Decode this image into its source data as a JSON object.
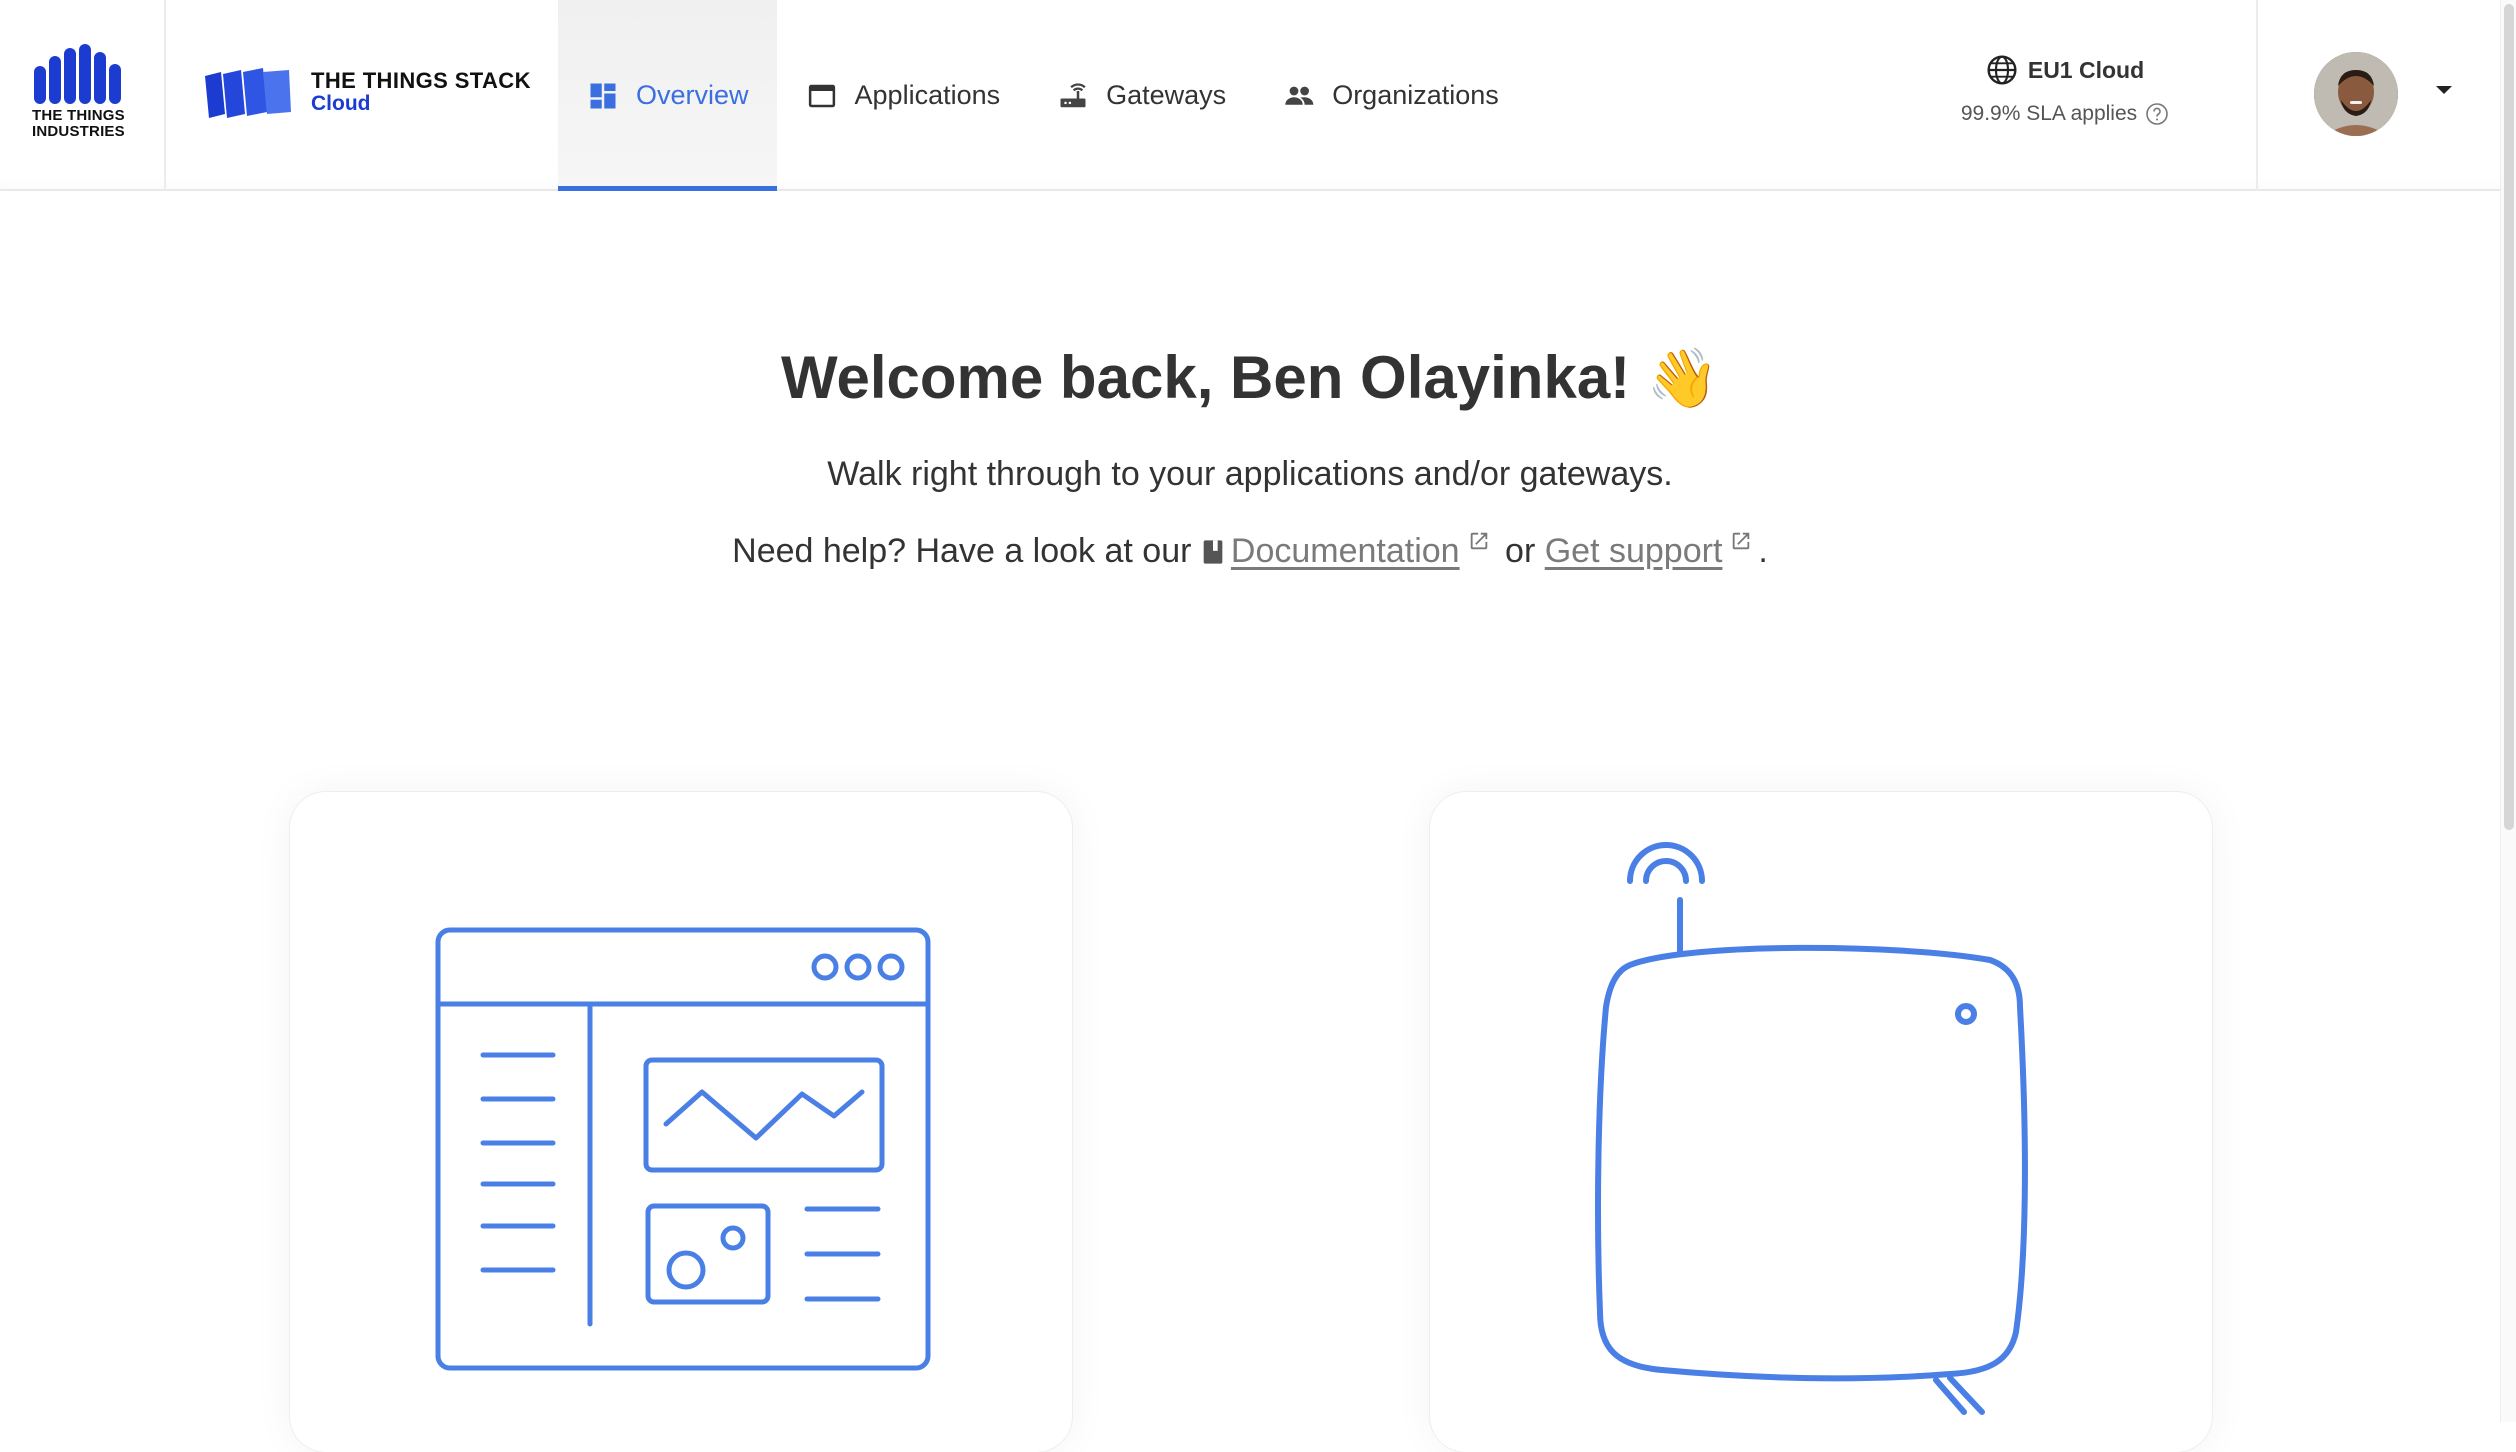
{
  "brand": {
    "company_line1": "THE THINGS",
    "company_line2": "INDUSTRIES",
    "product_title": "THE THINGS STACK",
    "product_sub": "Cloud"
  },
  "nav": {
    "items": [
      {
        "label": "Overview",
        "icon": "dashboard-icon",
        "active": true
      },
      {
        "label": "Applications",
        "icon": "window-icon",
        "active": false
      },
      {
        "label": "Gateways",
        "icon": "router-icon",
        "active": false
      },
      {
        "label": "Organizations",
        "icon": "people-icon",
        "active": false
      }
    ]
  },
  "cluster": {
    "name": "EU1 Cloud",
    "sla": "99.9% SLA applies",
    "icon": "globe-icon"
  },
  "profile": {
    "avatar_icon": "user-avatar",
    "menu_icon": "caret-down-icon"
  },
  "welcome": {
    "title": "Welcome back, Ben Olayinka!",
    "wave": "👋",
    "subtitle": "Walk right through to your applications and/or gateways.",
    "help_prefix": "Need help? Have a look at our",
    "doc_label": "Documentation",
    "or": "or",
    "support_label": "Get support",
    "period": "."
  },
  "cards": [
    {
      "name": "applications-card",
      "icon": "application-illustration"
    },
    {
      "name": "gateways-card",
      "icon": "gateway-illustration"
    }
  ],
  "colors": {
    "accent": "#3b6fe0",
    "illustration": "#4a7fe6",
    "brand_blue": "#1c3bd1"
  }
}
